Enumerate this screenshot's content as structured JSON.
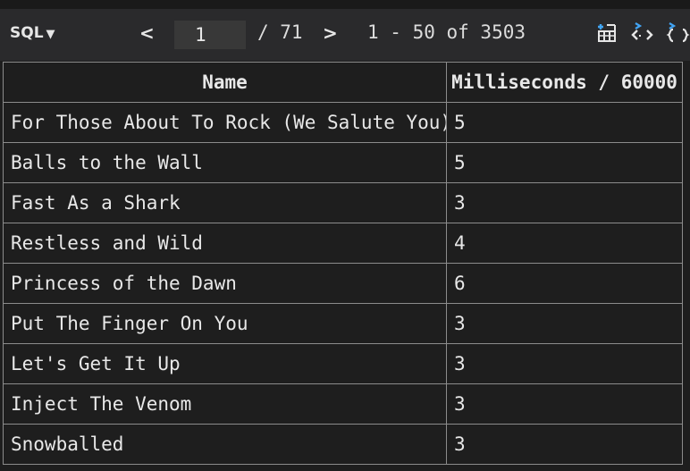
{
  "toolbar": {
    "mode_label": "SQL",
    "mode_caret": "▼",
    "prev_label": "<",
    "page_value": "1",
    "page_total": "/ 71",
    "next_label": ">",
    "row_range": "1 - 50 of 3503",
    "icons": [
      "table-view-icon",
      "code-view-icon",
      "json-view-icon"
    ]
  },
  "table": {
    "columns": [
      "Name",
      "Milliseconds / 60000"
    ],
    "rows": [
      [
        "For Those About To Rock (We Salute You)",
        "5"
      ],
      [
        "Balls to the Wall",
        "5"
      ],
      [
        "Fast As a Shark",
        "3"
      ],
      [
        "Restless and Wild",
        "4"
      ],
      [
        "Princess of the Dawn",
        "6"
      ],
      [
        "Put The Finger On You",
        "3"
      ],
      [
        "Let's Get It Up",
        "3"
      ],
      [
        "Inject The Venom",
        "3"
      ],
      [
        "Snowballed",
        "3"
      ]
    ]
  },
  "colors": {
    "background": "#1e1e1e",
    "toolbar": "#2a2a2c",
    "accent": "#42a5f5",
    "border": "#8c8c8c"
  }
}
